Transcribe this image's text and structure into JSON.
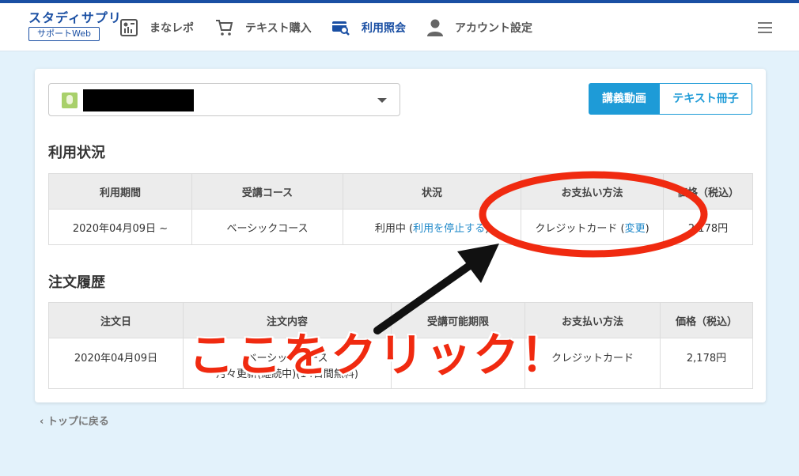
{
  "header": {
    "logo_main": "スタディサプリ",
    "logo_sub": "サポートWeb",
    "nav": [
      {
        "label": "まなレポ",
        "icon": "report-icon"
      },
      {
        "label": "テキスト購入",
        "icon": "cart-icon"
      },
      {
        "label": "利用照会",
        "icon": "card-search-icon",
        "active": true
      },
      {
        "label": "アカウント設定",
        "icon": "person-icon"
      }
    ]
  },
  "toggle": {
    "video": "講義動画",
    "text": "テキスト冊子"
  },
  "usage": {
    "title": "利用状況",
    "headers": [
      "利用期間",
      "受講コース",
      "状況",
      "お支払い方法",
      "価格（税込）"
    ],
    "row": {
      "period": "2020年04月09日 ~",
      "course": "ベーシックコース",
      "status": "利用中",
      "stop_link": "利用を停止する",
      "payment": "クレジットカード",
      "change_link": "変更",
      "price": "2,178円"
    }
  },
  "orders": {
    "title": "注文履歴",
    "headers": [
      "注文日",
      "注文内容",
      "受講可能期限",
      "お支払い方法",
      "価格（税込）"
    ],
    "row": {
      "date": "2020年04月09日",
      "content_line1": "ベーシックコース",
      "content_line2": "月々更新(継続中)(14日間無料)",
      "deadline": "",
      "payment": "クレジットカード",
      "price": "2,178円"
    }
  },
  "back_link": "トップに戻る",
  "annotation": {
    "text": "ここをクリック！",
    "color": "#f02a10"
  },
  "colors": {
    "brand": "#1a4fa3",
    "accent": "#1e9bd7",
    "link": "#1e88c9",
    "background": "#e3f2fb"
  }
}
